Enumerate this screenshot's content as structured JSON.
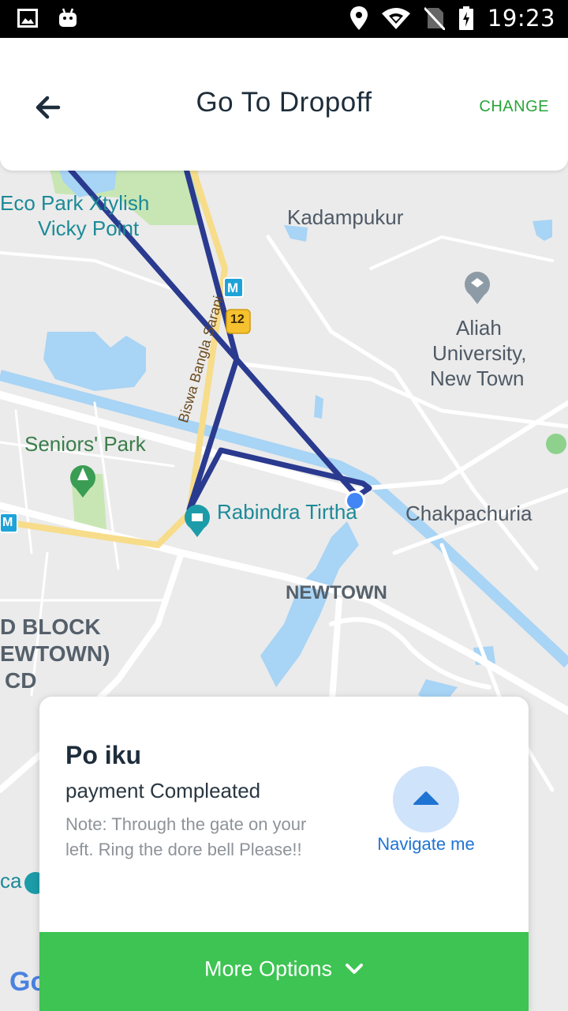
{
  "status_bar": {
    "time": "19:23",
    "left_icons": [
      "image-icon",
      "android-icon"
    ],
    "right_icons": [
      "location-pin-icon",
      "wifi-icon",
      "no-sim-icon",
      "battery-charging-icon"
    ]
  },
  "header": {
    "title": "Go To Dropoff",
    "change_label": "CHANGE",
    "back_icon": "arrow-left-icon"
  },
  "map": {
    "labels": {
      "eco_park": "Eco Park Xtylish",
      "vicky_point": "Vicky Point",
      "kadampukur": "Kadampukur",
      "aliah_1": "Aliah",
      "aliah_2": "University,",
      "aliah_3": "New Town",
      "seniors_park": "Seniors' Park",
      "rabindra_tirtha": "Rabindra Tirtha",
      "chakpachuria": "Chakpachuria",
      "newtown": "NEWTOWN",
      "d_block_1": "D BLOCK",
      "d_block_2": "EWTOWN)",
      "d_block_3": "CD",
      "ca": "ca",
      "road_name": "Biswa Bangla Sarani",
      "route_badge": "12",
      "metro_1": "M",
      "metro_2": "M",
      "google_mark": "Go"
    },
    "colors": {
      "route": "#2a3a8f",
      "water": "#a8d4f5",
      "park": "#c8e6b4",
      "road": "#ffffff",
      "highway": "#f7dc8a",
      "current_location": "#4285f4"
    }
  },
  "card": {
    "customer_name": "Po iku",
    "payment_status": "payment Compleated",
    "note": "Note: Through the gate on your left. Ring the dore bell Please!!",
    "navigate_label": "Navigate me",
    "navigate_icon": "triangle-up-icon",
    "more_options_label": "More Options",
    "more_options_icon": "chevron-down-icon",
    "accent_green": "#3dc453",
    "accent_blue": "#1f73d3"
  }
}
